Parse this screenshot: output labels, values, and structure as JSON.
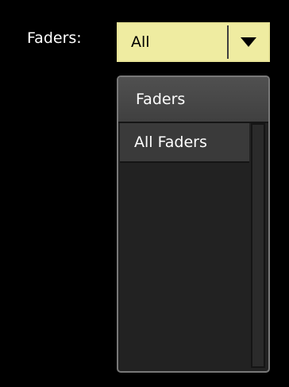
{
  "filter": {
    "label": "Faders:",
    "selected_value": "All"
  },
  "dropdown": {
    "header": "Faders",
    "items": [
      {
        "label": "All Faders"
      }
    ]
  },
  "colors": {
    "background": "#000000",
    "combo_fill": "#efeca1",
    "panel": "#222222",
    "header": "#464646",
    "item": "#3a3a3a"
  },
  "icons": {
    "combo_button": "triangle-down-icon"
  }
}
